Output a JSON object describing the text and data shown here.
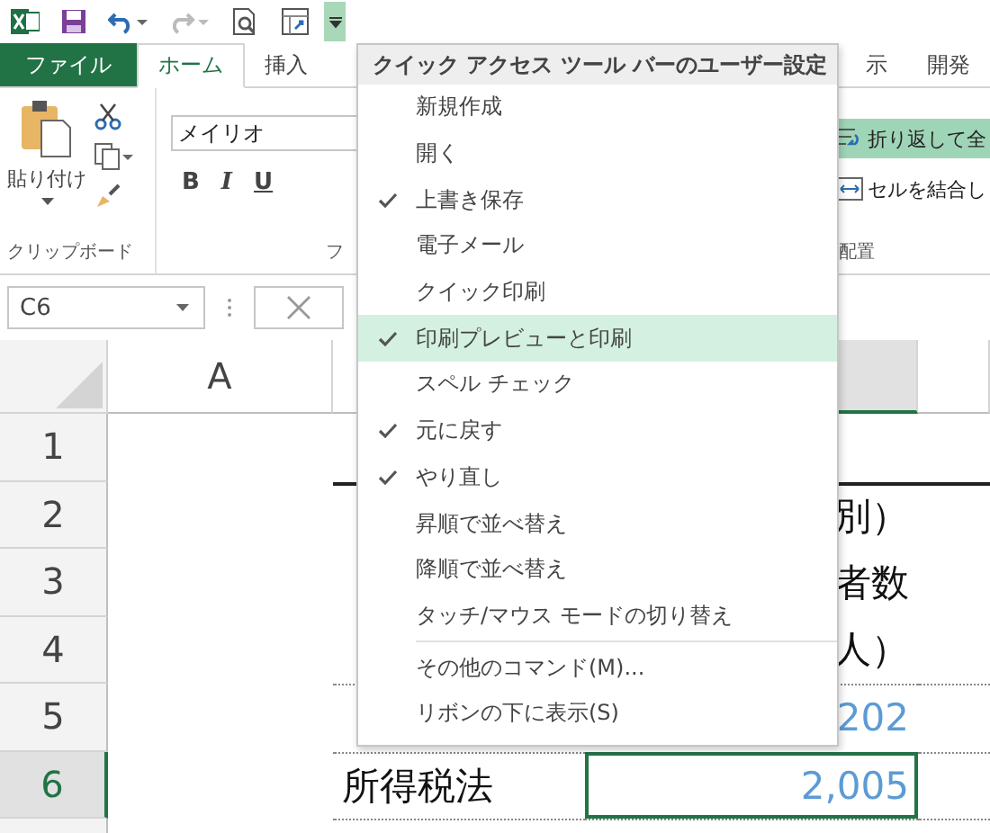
{
  "tabs": [
    {
      "label": "ファイル",
      "kind": "file",
      "selected": false
    },
    {
      "label": "ホーム",
      "kind": "tab",
      "selected": true
    },
    {
      "label": "挿入",
      "kind": "tab",
      "selected": false
    },
    {
      "label": "示",
      "kind": "tab",
      "selected": false
    },
    {
      "label": "開発",
      "kind": "tab",
      "selected": false
    }
  ],
  "ribbon": {
    "clipboard": {
      "paste_label": "貼り付け",
      "group_label": "クリップボード"
    },
    "font": {
      "font_name": "メイリオ",
      "buttons": [
        "B",
        "I",
        "U"
      ],
      "group_label": "フ"
    },
    "alignment": {
      "wrap_label": "折り返して全",
      "wrap_on": true,
      "merge_label": "セルを結合し",
      "group_label": "配置"
    }
  },
  "formula_bar": {
    "name_box": "C6"
  },
  "sheet": {
    "column_a": "A",
    "rows": [
      {
        "number": "1",
        "selected": false,
        "b": "",
        "c": ""
      },
      {
        "number": "2",
        "selected": false,
        "b": "",
        "c": "別）"
      },
      {
        "number": "3",
        "selected": false,
        "b": "",
        "c": "者数"
      },
      {
        "number": "4",
        "selected": false,
        "b": "",
        "c": "人）"
      },
      {
        "number": "5",
        "selected": false,
        "b": "",
        "c": "202"
      },
      {
        "number": "6",
        "selected": true,
        "b": "所得税法",
        "c": "2,005"
      }
    ]
  },
  "menu": {
    "title": "クイック アクセス ツール バーのユーザー設定",
    "items": [
      {
        "label": "新規作成",
        "checked": false,
        "selected": false
      },
      {
        "label": "開く",
        "checked": false,
        "selected": false
      },
      {
        "label": "上書き保存",
        "checked": true,
        "selected": false
      },
      {
        "label": "電子メール",
        "checked": false,
        "selected": false
      },
      {
        "label": "クイック印刷",
        "checked": false,
        "selected": false
      },
      {
        "label": "印刷プレビューと印刷",
        "checked": true,
        "selected": true
      },
      {
        "label": "スペル チェック",
        "checked": false,
        "selected": false
      },
      {
        "label": "元に戻す",
        "checked": true,
        "selected": false
      },
      {
        "label": "やり直し",
        "checked": true,
        "selected": false
      },
      {
        "label": "昇順で並べ替え",
        "checked": false,
        "selected": false
      },
      {
        "label": "降順で並べ替え",
        "checked": false,
        "selected": false
      },
      {
        "label": "タッチ/マウス モードの切り替え",
        "checked": false,
        "selected": false
      }
    ],
    "footer_items": [
      {
        "label": "その他のコマンド(M)..."
      },
      {
        "label": "リボンの下に表示(S)"
      }
    ]
  }
}
